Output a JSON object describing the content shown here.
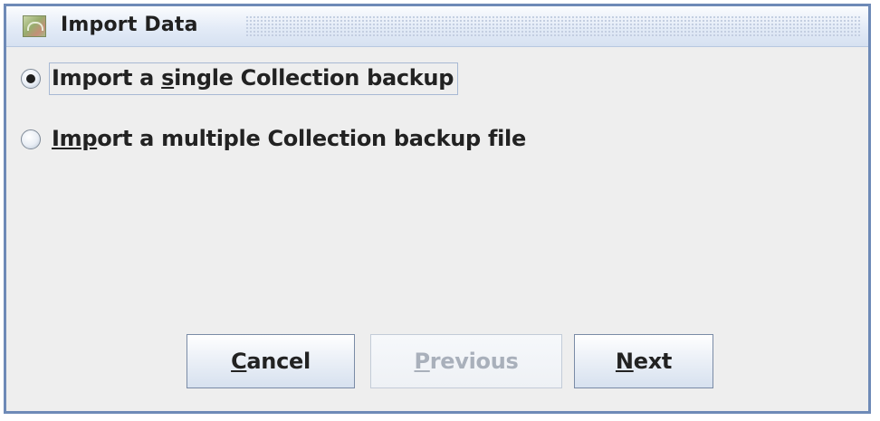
{
  "window": {
    "title": "Import Data",
    "icon": "import-data-app-icon"
  },
  "options": [
    {
      "label_pre": "Import a ",
      "mnemonic": "s",
      "label_post": "ingle Collection backup",
      "selected": true
    },
    {
      "label_pre": "",
      "mnemonic": "Imp",
      "label_post": "ort a multiple Collection backup file",
      "selected": false
    }
  ],
  "buttons": {
    "cancel": {
      "mnemonic": "C",
      "rest": "ancel",
      "enabled": true
    },
    "previous": {
      "mnemonic": "P",
      "rest": "revious",
      "enabled": false
    },
    "next": {
      "mnemonic": "N",
      "rest": "ext",
      "enabled": true
    }
  },
  "colors": {
    "frame_border": "#6e8ab7",
    "background": "#eeeeee",
    "disabled_text": "#a9b0bb"
  }
}
